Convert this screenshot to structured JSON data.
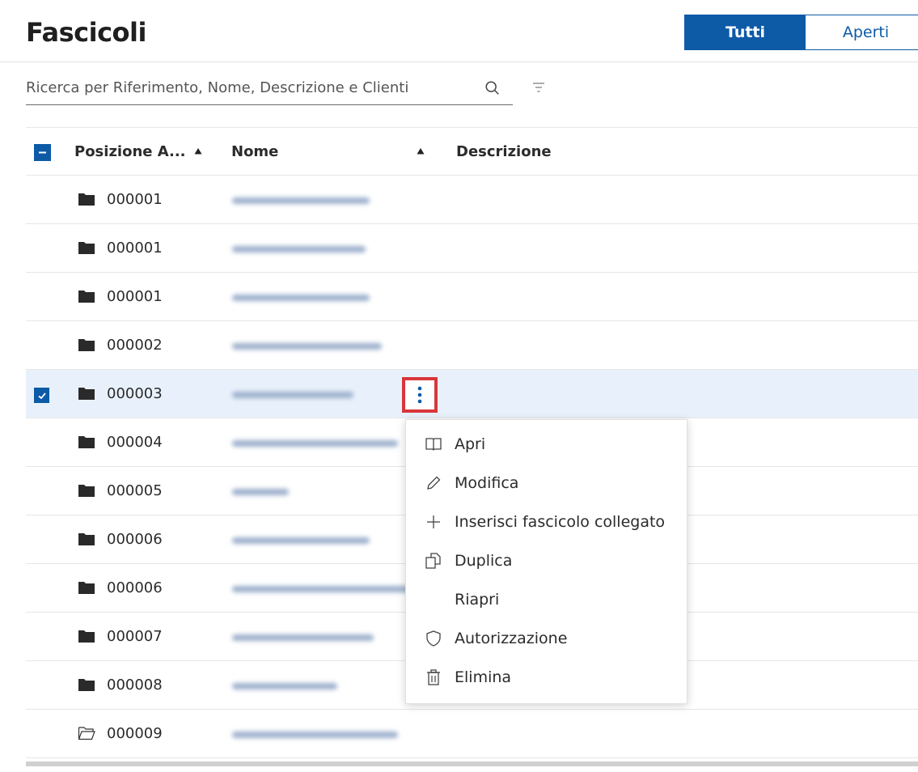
{
  "page": {
    "title": "Fascicoli"
  },
  "filter_tabs": [
    {
      "label": "Tutti",
      "active": true
    },
    {
      "label": "Aperti",
      "active": false
    }
  ],
  "search": {
    "placeholder": "Ricerca per Riferimento, Nome, Descrizione e Clienti",
    "value": ""
  },
  "table": {
    "headers": {
      "position": "Posizione A...",
      "name": "Nome",
      "description": "Descrizione"
    },
    "rows": [
      {
        "code": "000001",
        "folder": "closed",
        "selected": false
      },
      {
        "code": "000001",
        "folder": "closed",
        "selected": false
      },
      {
        "code": "000001",
        "folder": "closed",
        "selected": false
      },
      {
        "code": "000002",
        "folder": "closed",
        "selected": false
      },
      {
        "code": "000003",
        "folder": "closed",
        "selected": true
      },
      {
        "code": "000004",
        "folder": "closed",
        "selected": false
      },
      {
        "code": "000005",
        "folder": "closed",
        "selected": false
      },
      {
        "code": "000006",
        "folder": "closed",
        "selected": false
      },
      {
        "code": "000006",
        "folder": "closed",
        "selected": false
      },
      {
        "code": "000007",
        "folder": "closed",
        "selected": false
      },
      {
        "code": "000008",
        "folder": "closed",
        "selected": false
      },
      {
        "code": "000009",
        "folder": "open",
        "selected": false
      }
    ]
  },
  "context_menu": {
    "items": [
      {
        "label": "Apri",
        "icon": "book-icon"
      },
      {
        "label": "Modifica",
        "icon": "pencil-icon"
      },
      {
        "label": "Inserisci fascicolo collegato",
        "icon": "plus-icon"
      },
      {
        "label": "Duplica",
        "icon": "duplicate-icon"
      },
      {
        "label": "Riapri",
        "icon": ""
      },
      {
        "label": "Autorizzazione",
        "icon": "shield-icon"
      },
      {
        "label": "Elimina",
        "icon": "trash-icon"
      }
    ]
  },
  "colors": {
    "accent": "#0d5aa7",
    "highlight": "#d8363a",
    "selected_row": "#e8f1fb"
  }
}
